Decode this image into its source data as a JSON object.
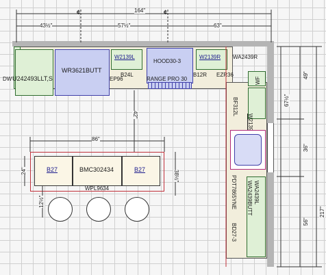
{
  "dimensions": {
    "top_overall": "164\"",
    "top_left": "43½\"",
    "top_mid": "57½\"",
    "top_right": "63\"",
    "island_width": "86\"",
    "island_depth": "24\"",
    "island_to_cabinet": "42\"",
    "island_overhang": "12½\"",
    "island_side": "38½\"",
    "right_a": "49\"",
    "right_b": "67½\"",
    "right_c": "36\"",
    "right_d": "56\"",
    "right_total": "217\""
  },
  "centerline_symbol": "¢",
  "cabinets": {
    "dw": "DW",
    "u242493": "U242493LLT,S",
    "wr3621": "WR3621BUTT",
    "ep96": "EP96",
    "w2139l_top": "W2139L",
    "b24l": "B24L",
    "hood": "HOOD30-3",
    "range": "RANGE PRO 30",
    "w2139r": "W2139R",
    "b12r": "B12R",
    "wa2439r": "WA2439R",
    "ezr36": "EZR36",
    "wf": "WF",
    "w2139l_right": "W2139L",
    "bf312l": "BF312L",
    "pdt": "PDT7865YNE",
    "wa2439butt": "WA2439BUTT",
    "wa2439l": "WA2439L",
    "bd27": "BD27-3",
    "island_b27_left": "B27",
    "island_bmc": "BMC302434",
    "island_b27_right": "B27",
    "island_panel": "WPL9634"
  }
}
